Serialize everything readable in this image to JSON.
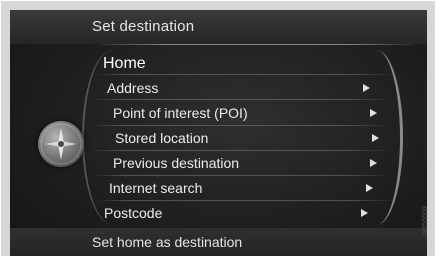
{
  "header": {
    "title": "Set destination"
  },
  "menu": {
    "items": [
      {
        "label": "Home"
      },
      {
        "label": "Address"
      },
      {
        "label": "Point of interest (POI)"
      },
      {
        "label": "Stored location"
      },
      {
        "label": "Previous destination"
      },
      {
        "label": "Internet search"
      },
      {
        "label": "Postcode"
      }
    ]
  },
  "footer": {
    "hint": "Set home as destination"
  },
  "figure_code": "G050509",
  "icons": {
    "submenu": "chevron-right-icon",
    "knob": "navigation-compass-icon"
  },
  "colors": {
    "background": "#1f1f1f",
    "text": "#ececec",
    "frame": "#d6d6d6"
  }
}
